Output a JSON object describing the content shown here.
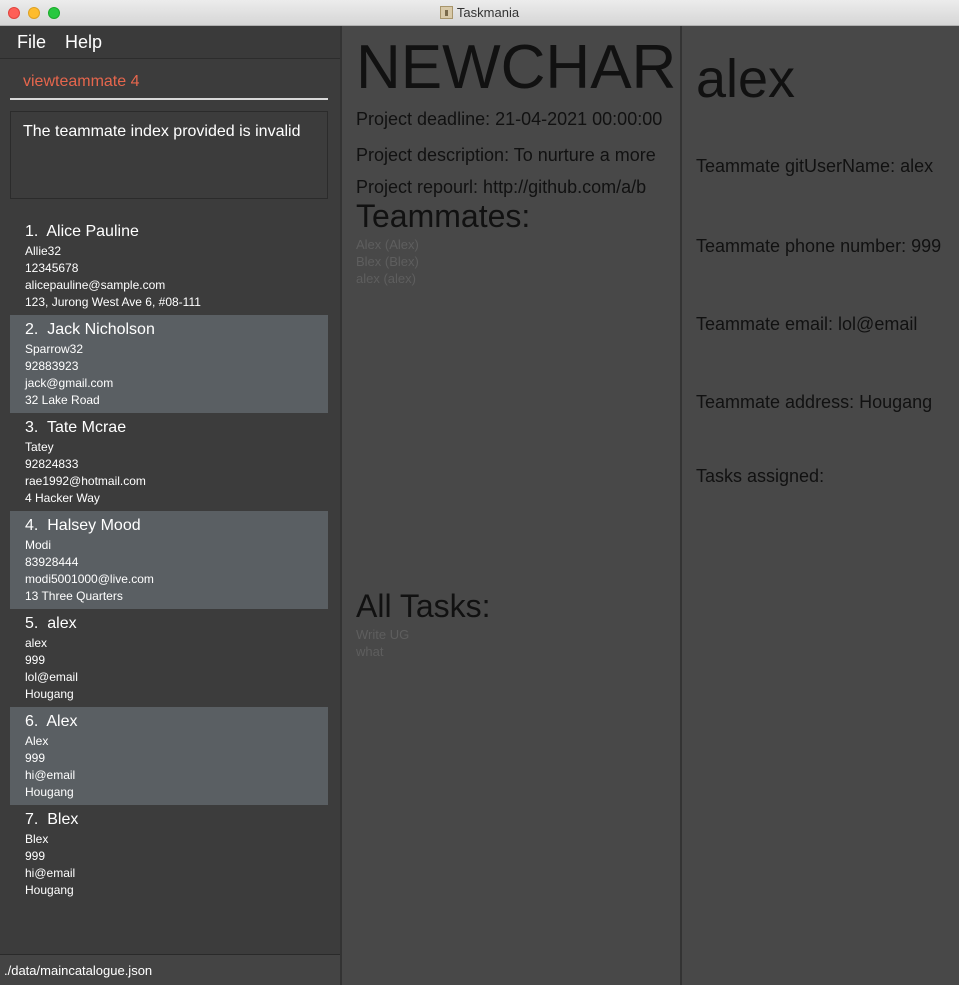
{
  "window": {
    "title": "Taskmania"
  },
  "menu": {
    "file": "File",
    "help": "Help"
  },
  "command": {
    "text": "viewteammate 4"
  },
  "result": {
    "text": "The teammate index provided is invalid"
  },
  "persons": [
    {
      "index": "1.",
      "name": "Alice Pauline",
      "git": "Allie32",
      "phone": "12345678",
      "email": "alicepauline@sample.com",
      "address": "123, Jurong West Ave 6, #08-111"
    },
    {
      "index": "2.",
      "name": "Jack Nicholson",
      "git": "Sparrow32",
      "phone": "92883923",
      "email": "jack@gmail.com",
      "address": "32 Lake Road"
    },
    {
      "index": "3.",
      "name": "Tate Mcrae",
      "git": "Tatey",
      "phone": "92824833",
      "email": "rae1992@hotmail.com",
      "address": "4 Hacker Way"
    },
    {
      "index": "4.",
      "name": "Halsey Mood",
      "git": "Modi",
      "phone": "83928444",
      "email": "modi5001000@live.com",
      "address": "13 Three Quarters"
    },
    {
      "index": "5.",
      "name": "alex",
      "git": "alex",
      "phone": "999",
      "email": "lol@email",
      "address": "Hougang"
    },
    {
      "index": "6.",
      "name": "Alex",
      "git": "Alex",
      "phone": "999",
      "email": "hi@email",
      "address": "Hougang"
    },
    {
      "index": "7.",
      "name": "Blex",
      "git": "Blex",
      "phone": "999",
      "email": "hi@email",
      "address": "Hougang"
    }
  ],
  "status": {
    "path": "./data/maincatalogue.json"
  },
  "project": {
    "name": "NEWCHARLES",
    "deadline": "Project deadline: 21-04-2021 00:00:00",
    "description": "Project description: To nurture a more",
    "repo": "Project repourl: http://github.com/a/b",
    "teammates_heading": "Teammates:",
    "teammates": [
      "Alex (Alex)",
      "Blex (Blex)",
      "alex (alex)"
    ],
    "tasks_heading": "All Tasks:",
    "tasks": [
      "Write UG",
      "what"
    ]
  },
  "teammate": {
    "name": "alex",
    "git": "Teammate gitUserName: alex",
    "phone": "Teammate phone number: 999",
    "email": "Teammate email: lol@email",
    "address": "Teammate address: Hougang",
    "tasks_label": "Tasks assigned:"
  }
}
